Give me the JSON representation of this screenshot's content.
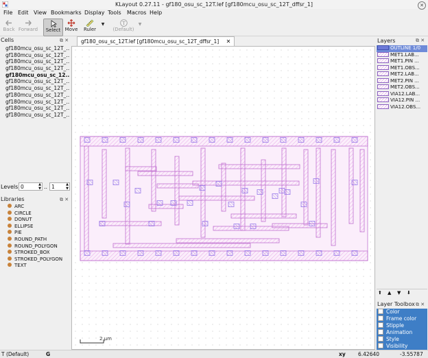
{
  "window": {
    "title": "KLayout 0.27.11 - gf180_osu_sc_12T.lef [gf180mcu_osu_sc_12T_dffsr_1]"
  },
  "menu": [
    "File",
    "Edit",
    "View",
    "Bookmarks",
    "Display",
    "Tools",
    "Macros",
    "Help"
  ],
  "toolbar": {
    "back": "Back",
    "forward": "Forward",
    "select": "Select",
    "move": "Move",
    "ruler": "Ruler",
    "default": "(Default)"
  },
  "cells": {
    "title": "Cells",
    "items": [
      "gf180mcu_osu_sc_12T_...",
      "gf180mcu_osu_sc_12T_...",
      "gf180mcu_osu_sc_12T_...",
      "gf180mcu_osu_sc_12T_...",
      "gf180mcu_osu_sc_12...",
      "gf180mcu_osu_sc_12T_...",
      "gf180mcu_osu_sc_12T_...",
      "gf180mcu_osu_sc_12T_...",
      "gf180mcu_osu_sc_12T_...",
      "gf180mcu_osu_sc_12T_...",
      "gf180mcu_osu_sc_12T_..."
    ]
  },
  "levels": {
    "label": "Levels",
    "from": "0",
    "sep": "..",
    "to": "1"
  },
  "libraries": {
    "title": "Libraries",
    "items": [
      "ARC",
      "CIRCLE",
      "DONUT",
      "ELLIPSE",
      "PIE",
      "ROUND_PATH",
      "ROUND_POLYGON",
      "STROKED_BOX",
      "STROKED_POLYGON",
      "TEXT"
    ]
  },
  "layers": {
    "title": "Layers",
    "items": [
      "OUTLINE 1/0",
      "MET1.LAB...",
      "MET1.PIN ...",
      "MET1.OBS...",
      "MET2.LAB...",
      "MET2.PIN ...",
      "MET2.OBS...",
      "VIA12.LAB...",
      "VIA12.PIN ...",
      "VIA12.OBS..."
    ]
  },
  "toolbox": {
    "title": "Layer Toolbox",
    "items": [
      "Color",
      "Frame color",
      "Stipple",
      "Animation",
      "Style",
      "Visibility"
    ]
  },
  "tab": {
    "label": "gf180_osu_sc_12T.lef [gf180mcu_osu_sc_12T_dffsr_1]"
  },
  "scale_bar": "2 µm",
  "status": {
    "mode": "T (Default)",
    "g": "G",
    "xy_label": "xy",
    "x": "6.42640",
    "y": "-3.55787"
  },
  "colors": {
    "metal": "#c070d0",
    "via": "#9a7bea",
    "selection": "#6e8ad8",
    "toolbox": "#3e7ec6"
  },
  "icons": [
    "klayout-logo-icon",
    "close-icon",
    "back-icon",
    "forward-icon",
    "select-arrow-icon",
    "move-icon",
    "ruler-icon",
    "template-icon"
  ]
}
